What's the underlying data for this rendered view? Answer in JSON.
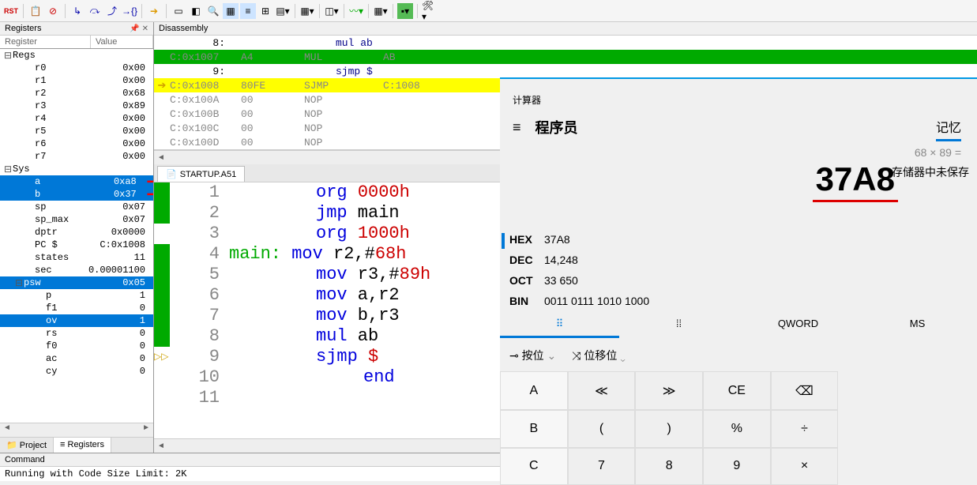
{
  "toolbar_icons": [
    "RST",
    "disable",
    "stop",
    "step-in",
    "step-over",
    "step-out",
    "run-to",
    "sep",
    "run",
    "sep",
    "window",
    "find",
    "zoom",
    "col",
    "highlight",
    "print",
    "list",
    "sep",
    "grid",
    "sep",
    "wave",
    "sep",
    "mem",
    "sep",
    "chart",
    "sep",
    "watch",
    "sep",
    "tools"
  ],
  "panes": {
    "registers_title": "Registers",
    "disasm_title": "Disassembly",
    "command_title": "Command"
  },
  "reg_header": {
    "c1": "Register",
    "c2": "Value"
  },
  "regs": {
    "group": "Regs",
    "items": [
      {
        "n": "r0",
        "v": "0x00"
      },
      {
        "n": "r1",
        "v": "0x00"
      },
      {
        "n": "r2",
        "v": "0x68"
      },
      {
        "n": "r3",
        "v": "0x89"
      },
      {
        "n": "r4",
        "v": "0x00"
      },
      {
        "n": "r5",
        "v": "0x00"
      },
      {
        "n": "r6",
        "v": "0x00"
      },
      {
        "n": "r7",
        "v": "0x00"
      }
    ]
  },
  "sys": {
    "group": "Sys",
    "items": [
      {
        "n": "a",
        "v": "0xa8",
        "sel": true,
        "mod": true
      },
      {
        "n": "b",
        "v": "0x37",
        "sel": true,
        "mod": true
      },
      {
        "n": "sp",
        "v": "0x07"
      },
      {
        "n": "sp_max",
        "v": "0x07"
      },
      {
        "n": "dptr",
        "v": "0x0000"
      },
      {
        "n": "PC  $",
        "v": "C:0x1008"
      },
      {
        "n": "states",
        "v": "11"
      },
      {
        "n": "sec",
        "v": "0.00001100"
      }
    ],
    "psw": {
      "n": "psw",
      "v": "0x05",
      "sel": true,
      "flags": [
        {
          "n": "p",
          "v": "1"
        },
        {
          "n": "f1",
          "v": "0"
        },
        {
          "n": "ov",
          "v": "1",
          "sel": true
        },
        {
          "n": "rs",
          "v": "0"
        },
        {
          "n": "f0",
          "v": "0"
        },
        {
          "n": "ac",
          "v": "0"
        },
        {
          "n": "cy",
          "v": "0"
        }
      ]
    }
  },
  "left_tabs": [
    "Project",
    "Registers"
  ],
  "disasm": [
    {
      "t": "src",
      "num": "8:",
      "txt": "mul ab"
    },
    {
      "t": "asm",
      "bp": true,
      "addr": "C:0x1007",
      "opc": "A4",
      "mn": "MUL",
      "arg": "AB"
    },
    {
      "t": "src",
      "num": "9:",
      "txt": "sjmp $"
    },
    {
      "t": "asm",
      "cur": true,
      "pc": true,
      "addr": "C:0x1008",
      "opc": "80FE",
      "mn": "SJMP",
      "arg": "C:1008"
    },
    {
      "t": "asm",
      "addr": "C:0x100A",
      "opc": "00",
      "mn": "NOP",
      "arg": ""
    },
    {
      "t": "asm",
      "addr": "C:0x100B",
      "opc": "00",
      "mn": "NOP",
      "arg": ""
    },
    {
      "t": "asm",
      "addr": "C:0x100C",
      "opc": "00",
      "mn": "NOP",
      "arg": ""
    },
    {
      "t": "asm",
      "addr": "C:0x100D",
      "opc": "00",
      "mn": "NOP",
      "arg": ""
    }
  ],
  "src_tab": "STARTUP.A51",
  "src_lines": [
    {
      "n": "1",
      "bp": true,
      "html": "<span class='dir'>org</span> <span class='num'>0000h</span>"
    },
    {
      "n": "2",
      "bp": true,
      "html": "<span class='kw'>jmp</span> main"
    },
    {
      "n": "3",
      "html": "<span class='dir'>org</span> <span class='num'>1000h</span>"
    },
    {
      "n": "4",
      "bp": true,
      "html": "<span class='lbl2'>main:</span>    <span class='kw'>mov</span> r2,#<span class='num'>68h</span>"
    },
    {
      "n": "5",
      "bp": true,
      "html": "<span class='kw'>mov</span> r3,#<span class='num'>89h</span>"
    },
    {
      "n": "6",
      "bp": true,
      "html": "<span class='kw'>mov</span> a,r2"
    },
    {
      "n": "7",
      "bp": true,
      "html": "<span class='kw'>mov</span> b,r3"
    },
    {
      "n": "8",
      "bp": true,
      "html": "<span class='kw'>mul</span> ab"
    },
    {
      "n": "9",
      "pc": true,
      "html": "<span class='kw'>sjmp</span> <span class='num'>$</span>"
    },
    {
      "n": "10",
      "html": "<span class='dir'>end</span>"
    },
    {
      "n": "11",
      "html": ""
    }
  ],
  "command_out": "Running with Code Size Limit: 2K",
  "calc": {
    "title": "计算器",
    "mode": "程序员",
    "mem_tab": "记忆",
    "expr": "68 × 89 =",
    "result": "37A8",
    "mem_msg": "存储器中未保存",
    "bases": [
      {
        "n": "HEX",
        "v": "37A8",
        "cur": true
      },
      {
        "n": "DEC",
        "v": "14,248"
      },
      {
        "n": "OCT",
        "v": "33 650"
      },
      {
        "n": "BIN",
        "v": "0011 0111 1010 1000"
      }
    ],
    "tabs": [
      "⠿",
      "⁞⁞",
      "QWORD",
      "MS"
    ],
    "bit_ops": {
      "a": "按位",
      "b": "位移位"
    },
    "keypad": [
      [
        "A",
        "≪",
        "≫",
        "CE",
        "⌫"
      ],
      [
        "B",
        "(",
        ")",
        "%",
        "÷"
      ],
      [
        "C",
        "7",
        "8",
        "9",
        "×"
      ]
    ]
  }
}
